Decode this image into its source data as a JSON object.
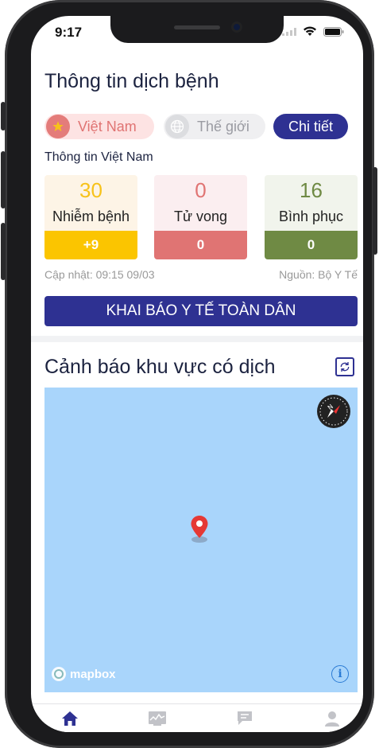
{
  "status_bar": {
    "time": "9:17"
  },
  "header": {
    "title": "Thông tin dịch bệnh"
  },
  "tabs": {
    "vietnam": "Việt Nam",
    "world": "Thế giới",
    "detail": "Chi tiết"
  },
  "section_vietnam": {
    "subtitle": "Thông tin Việt Nam"
  },
  "stats": [
    {
      "value": "30",
      "label": "Nhiễm bệnh",
      "delta": "+9",
      "color": "#f7c21a",
      "bg": "#fdf4e6",
      "bar": "#fbc500"
    },
    {
      "value": "0",
      "label": "Tử vong",
      "delta": "0",
      "color": "#e07473",
      "bg": "#fbeef0",
      "bar": "#e07473"
    },
    {
      "value": "16",
      "label": "Bình phục",
      "delta": "0",
      "color": "#6f8a44",
      "bg": "#f1f4ec",
      "bar": "#6f8a44"
    }
  ],
  "updated": "Cập nhật: 09:15 09/03",
  "source": "Nguồn: Bộ Y Tế",
  "declare_button": "KHAI BÁO Y TẾ TOÀN DÂN",
  "warning_section": {
    "title": "Cảnh báo khu vực có dịch"
  },
  "map": {
    "brand": "mapbox",
    "background": "#a9d5fb",
    "info_glyph": "i"
  },
  "tab_bar": {
    "icons": [
      "home-icon",
      "monitor-chart-icon",
      "chat-icon",
      "person-icon"
    ],
    "active": "home-icon"
  },
  "colors": {
    "primary": "#2e3192",
    "title": "#1c2340"
  }
}
